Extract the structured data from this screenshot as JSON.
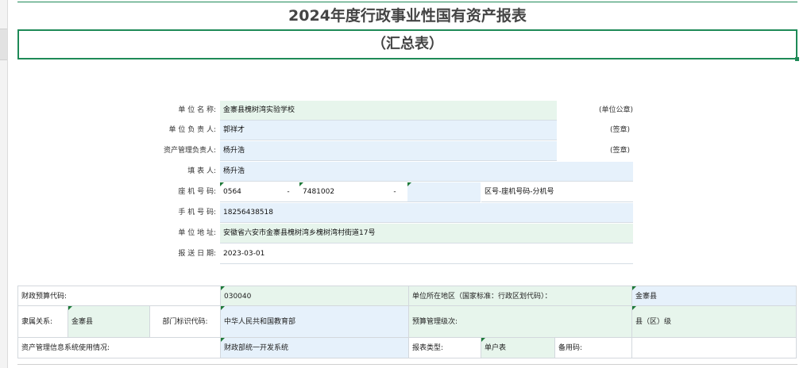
{
  "sheet": {
    "title": "2024年度行政事业性国有资产报表",
    "subtitle": "（汇总表）"
  },
  "form": {
    "unit_name": {
      "label": "单 位 名 称:",
      "value": "金寨县槐树湾实验学校",
      "note": "(单位公章)"
    },
    "unit_leader": {
      "label": "单 位 负 责 人:",
      "value": "郭祥才",
      "note": "(签章)"
    },
    "asset_manager": {
      "label": "资产管理负责人:",
      "value": "杨升浩",
      "note": "(签章)"
    },
    "preparer": {
      "label": "填 表 人:",
      "value": "杨升浩"
    },
    "phone": {
      "label": "座 机 号 码:",
      "area": "0564",
      "dash1": "-",
      "number": "7481002",
      "dash2": "-",
      "ext": "",
      "hint": "区号-座机号码-分机号"
    },
    "mobile": {
      "label": "手 机 号 码:",
      "value": "18256438518"
    },
    "address": {
      "label": "单 位 地 址:",
      "value": "安徽省六安市金寨县槐树湾乡槐树湾村街道17号"
    },
    "date": {
      "label": "报 送 日 期:",
      "value": "2023-03-01"
    }
  },
  "grid": {
    "budget_code_label": "财政预算代码:",
    "budget_code_value": "030040",
    "region_label": "单位所在地区（国家标准：行政区划代码）：",
    "region_value": "金寨县",
    "affiliation_label": "隶属关系:",
    "affiliation_value": "金寨县",
    "dept_code_label": "部门标识代码:",
    "dept_code_value": "中华人民共和国教育部",
    "budget_level_label": "预算管理级次:",
    "budget_level_value": "县（区）级",
    "system_label": "资产管理信息系统使用情况:",
    "system_value": "财政部统一开发系统",
    "report_type_label": "报表类型:",
    "report_type_value": "单户表",
    "backup_code_label": "备用码:",
    "backup_code_value": ""
  }
}
